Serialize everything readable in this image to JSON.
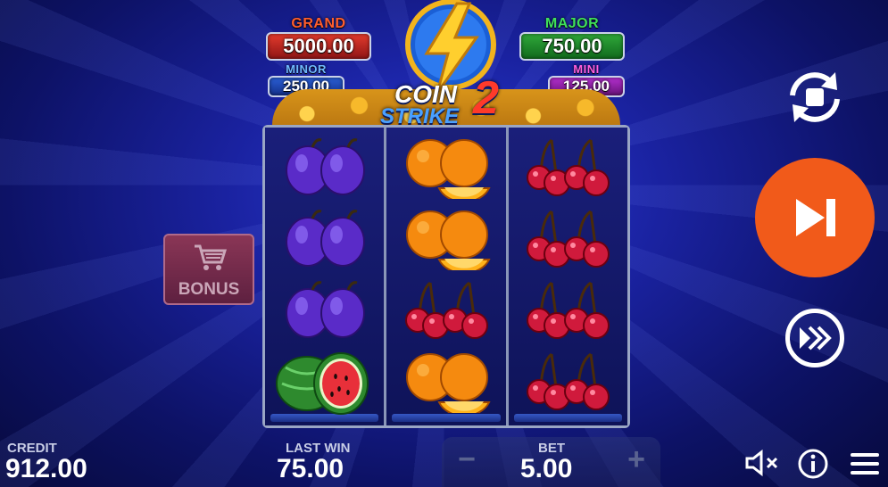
{
  "jackpots": {
    "grand": {
      "label": "GRAND",
      "value": "5000.00"
    },
    "major": {
      "label": "MAJOR",
      "value": "750.00"
    },
    "minor": {
      "label": "MINOR",
      "value": "250.00"
    },
    "mini": {
      "label": "MINI",
      "value": "125.00"
    }
  },
  "logo": {
    "line1": "COIN",
    "line2": "STRIKE",
    "number": "2"
  },
  "reels": [
    [
      "plum",
      "plum",
      "plum",
      "watermelon"
    ],
    [
      "orange",
      "orange",
      "cherry",
      "orange"
    ],
    [
      "cherry",
      "cherry",
      "cherry",
      "cherry"
    ]
  ],
  "bonus": {
    "label": "BONUS",
    "icon": "shopping-cart-icon"
  },
  "controls": {
    "autoplay_icon": "autoplay-icon",
    "spin_icon": "play-skip-icon",
    "turbo_icon": "fast-forward-icon",
    "sound_icon": "speaker-muted-icon",
    "info_icon": "info-icon",
    "menu_icon": "hamburger-menu-icon"
  },
  "footer": {
    "credit_label": "CREDIT",
    "credit_value": "912.00",
    "last_win_label": "LAST WIN",
    "last_win_value": "75.00",
    "bet_label": "BET",
    "bet_value": "5.00",
    "bet_minus": "−",
    "bet_plus": "+"
  },
  "colors": {
    "spin": "#f15a1a",
    "grand": "#e43b2d",
    "major": "#2fa83a",
    "minor": "#2a5fd6",
    "mini": "#b52fd0"
  }
}
